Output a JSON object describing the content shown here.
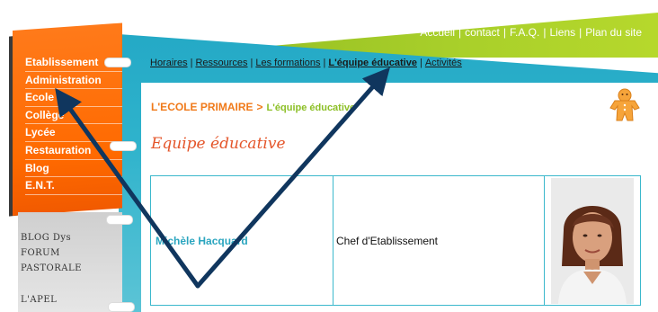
{
  "top_nav": [
    "Accueil",
    "contact",
    "F.A.Q.",
    "Liens",
    "Plan du site"
  ],
  "sidebar": {
    "items": [
      "Etablissement",
      "Administration",
      "Ecole",
      "Collège",
      "Lycée",
      "Restauration",
      "Blog",
      "E.N.T."
    ],
    "links": [
      "BLOG Dys",
      "FORUM",
      "PASTORALE",
      "L'APEL"
    ]
  },
  "sub_nav": {
    "items": [
      "Horaires",
      "Ressources",
      "Les formations",
      "L'équipe éducative",
      "Activités"
    ],
    "active": "L'équipe éducative"
  },
  "breadcrumb": {
    "section": "L'ECOLE PRIMAIRE",
    "separator": ">",
    "current": "L'équipe éducative"
  },
  "page_title": "Equipe éducative",
  "staff": [
    {
      "name": "Michèle Hacquard",
      "role": "Chef d'Etablissement"
    }
  ],
  "colors": {
    "orange_nav": "#ff6a00",
    "teal": "#2fb3cc",
    "green": "#a8cf2a",
    "title_red": "#e4552a",
    "name_teal": "#2aa5bf",
    "arrow": "#10365e"
  }
}
